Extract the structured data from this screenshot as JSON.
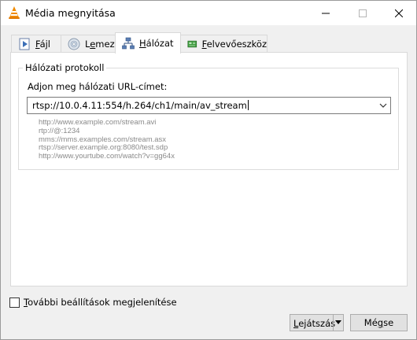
{
  "window": {
    "title": "Média megnyitása",
    "icon": "vlc-cone-icon"
  },
  "tabs": [
    {
      "label_underline": "F",
      "label_rest": "ájl",
      "icon": "file-icon",
      "active": false
    },
    {
      "label_pre": "L",
      "label_underline": "e",
      "label_rest": "mez",
      "icon": "disc-icon",
      "active": false
    },
    {
      "label_underline": "H",
      "label_rest": "álózat",
      "icon": "network-icon",
      "active": true
    },
    {
      "label_underline": "F",
      "label_rest": "elvevőeszköz",
      "icon": "capture-device-icon",
      "active": false
    }
  ],
  "network": {
    "group_title": "Hálózati protokoll",
    "url_label": "Adjon meg hálózati URL-címet:",
    "url_value": "rtsp://10.0.4.11:554/h.264/ch1/main/av_stream",
    "examples": [
      "http://www.example.com/stream.avi",
      "rtp://@:1234",
      "mms://mms.examples.com/stream.asx",
      "rtsp://server.example.org:8080/test.sdp",
      "http://www.yourtube.com/watch?v=gg64x"
    ]
  },
  "options": {
    "show_more_underline": "T",
    "show_more_rest": "ovábbi beállítások megjelenítése",
    "checked": false
  },
  "buttons": {
    "play_underline": "L",
    "play_rest": "ejátszás",
    "cancel_pre": "Mé",
    "cancel_underline": "g",
    "cancel_rest": "se"
  }
}
